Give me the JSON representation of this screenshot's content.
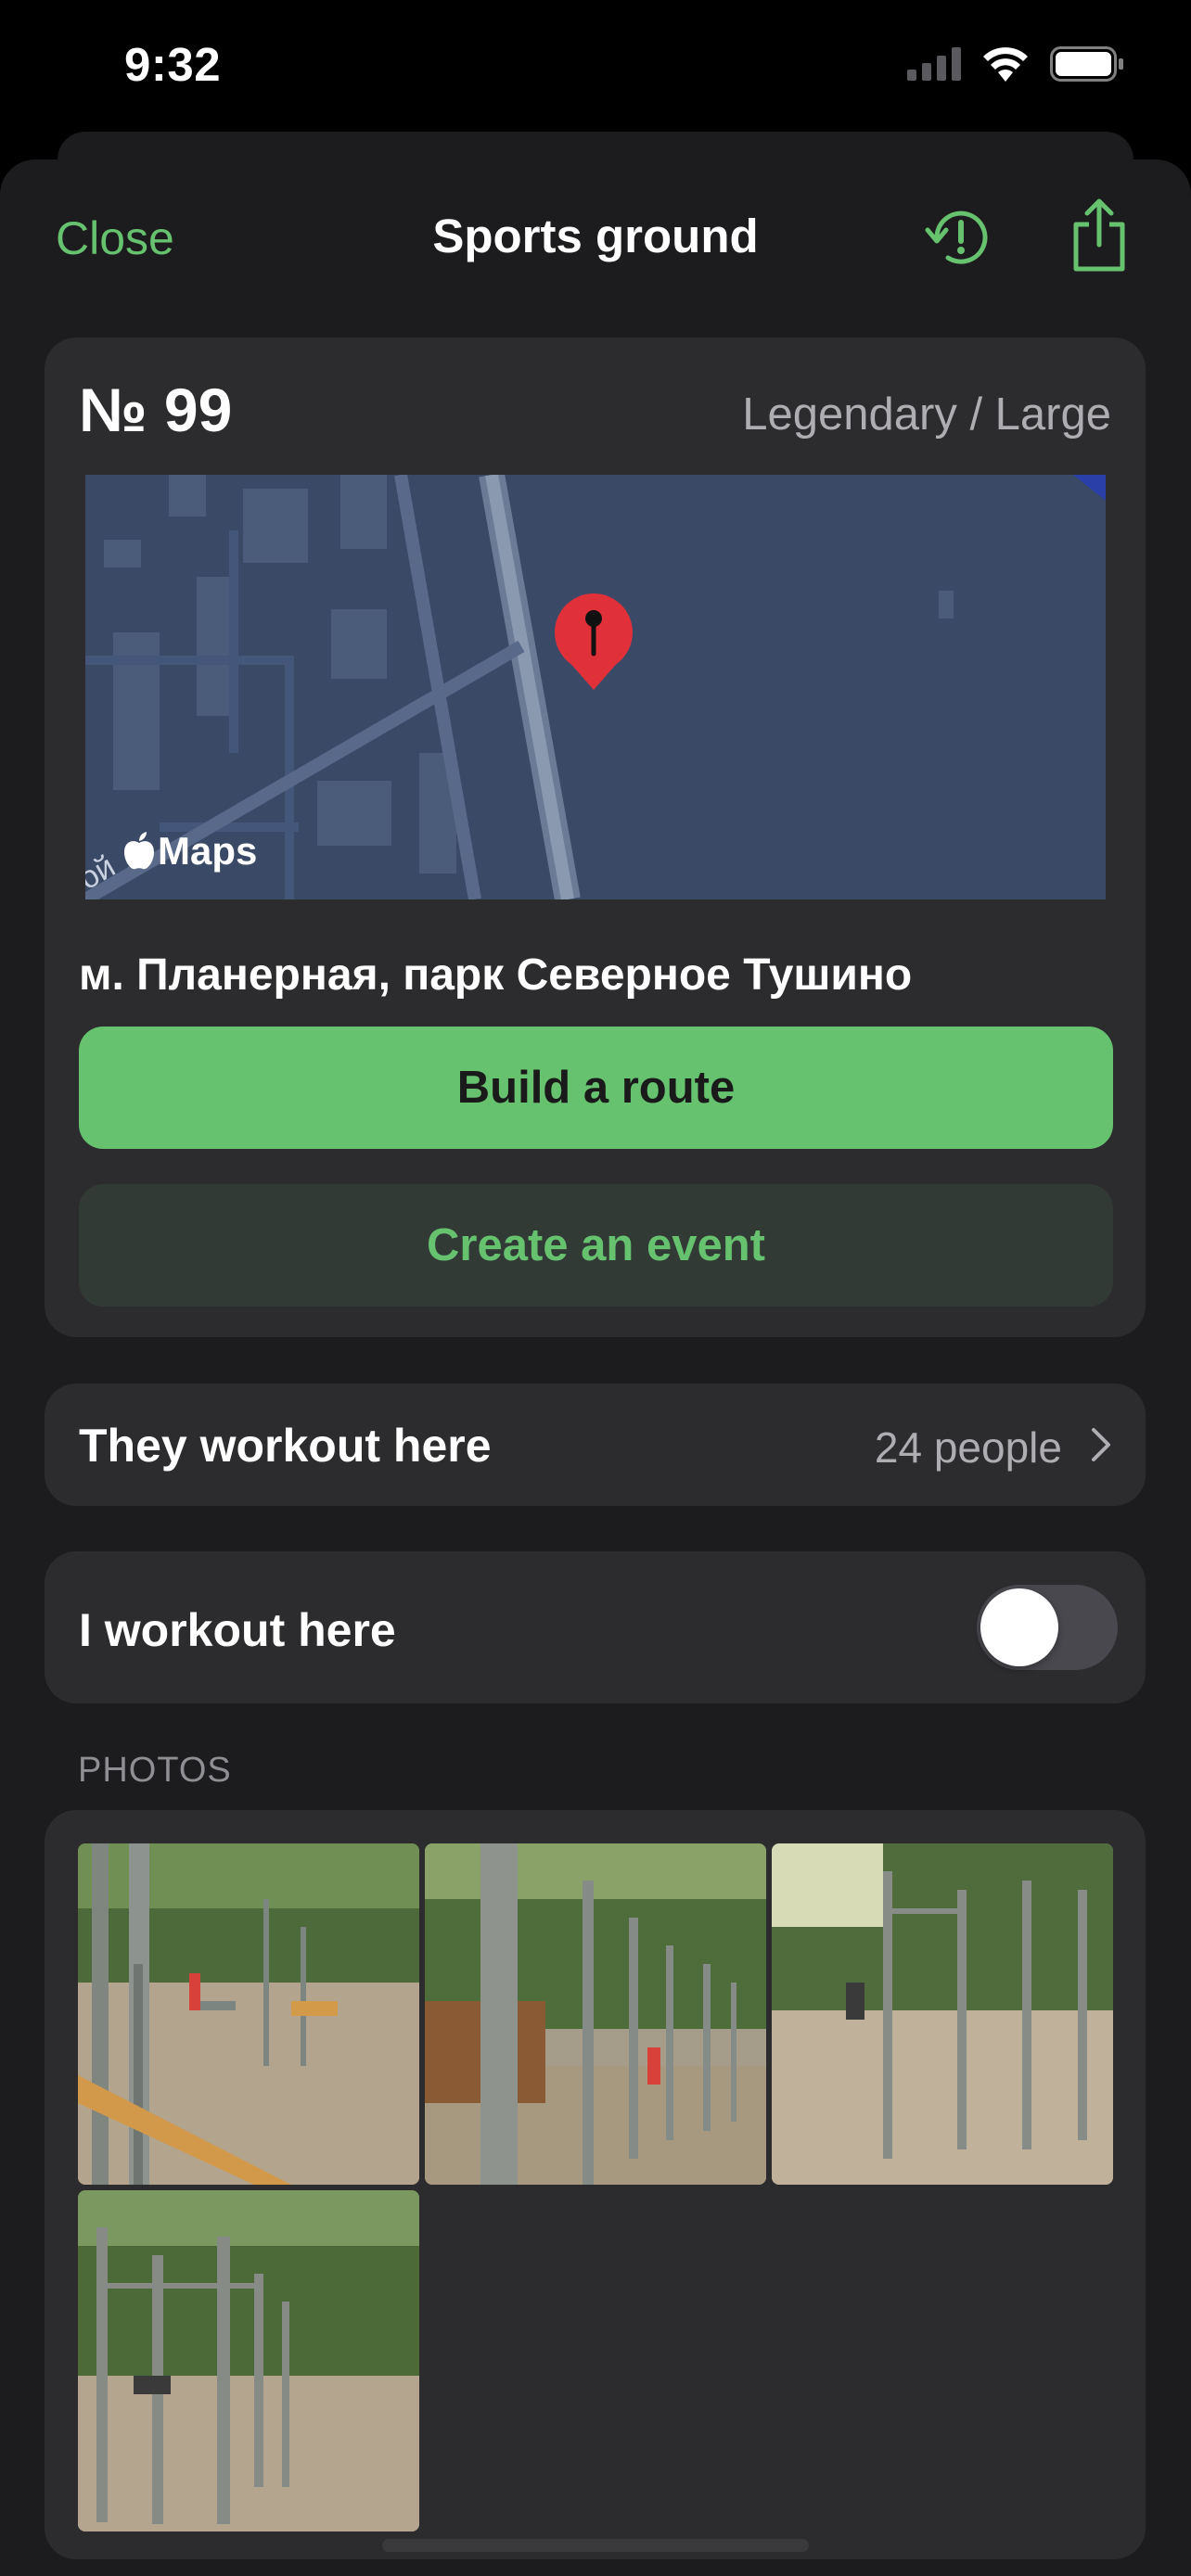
{
  "status_bar": {
    "time": "9:32",
    "icons": [
      "cellular-signal-icon",
      "wifi-icon",
      "battery-icon"
    ]
  },
  "nav": {
    "close_label": "Close",
    "title": "Sports ground",
    "icons": [
      "history-alert-icon",
      "share-icon"
    ]
  },
  "ground": {
    "number": "№ 99",
    "type": "Legendary / Large",
    "map_label": "Maps",
    "map_edge_text": "ой",
    "address": "м. Планерная, парк Северное Тушино",
    "route_button": "Build a route",
    "event_button": "Create an event"
  },
  "workout": {
    "label": "They workout here",
    "value": "24 people"
  },
  "my_workout": {
    "label": "I workout here",
    "toggle_on": false
  },
  "photos": {
    "header": "PHOTOS",
    "count": 4
  },
  "colors": {
    "accent": "#67c270",
    "background": "#1c1c1e",
    "card": "#2c2c2e"
  }
}
